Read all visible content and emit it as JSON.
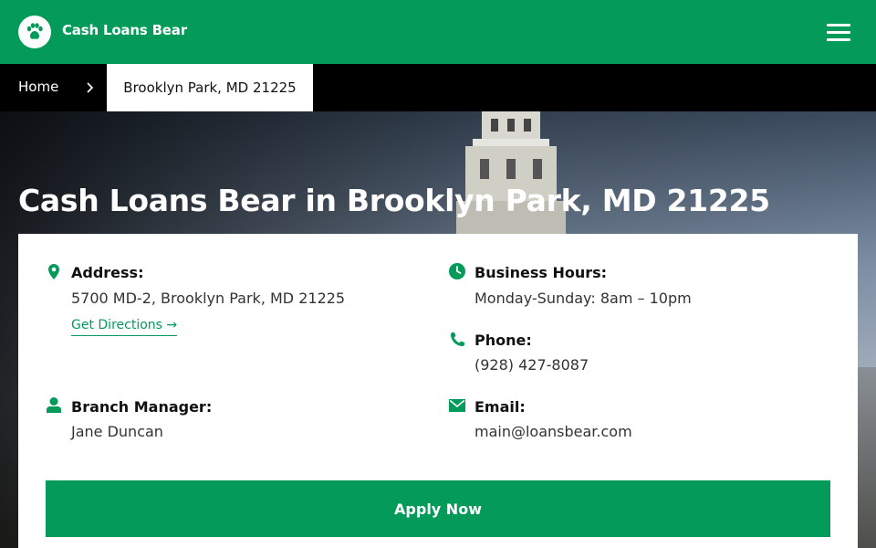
{
  "header": {
    "brand": "Cash Loans Bear",
    "logo_icon": "paw-icon",
    "menu_icon": "hamburger-menu-icon",
    "bg_color": "#049a5a"
  },
  "breadcrumb": {
    "home": "Home",
    "current": "Brooklyn Park, MD 21225"
  },
  "page": {
    "title": "Cash Loans Bear in Brooklyn Park, MD 21225"
  },
  "info": {
    "address": {
      "label": "Address:",
      "value": "5700 MD-2, Brooklyn Park, MD 21225",
      "link": "Get Directions",
      "icon": "map-pin-icon"
    },
    "hours": {
      "label": "Business Hours:",
      "value": "Monday-Sunday: 8am – 10pm",
      "icon": "clock-icon"
    },
    "phone": {
      "label": "Phone:",
      "value": "(928) 427-8087",
      "icon": "phone-icon"
    },
    "manager": {
      "label": "Branch Manager:",
      "value": "Jane Duncan",
      "icon": "user-icon"
    },
    "email": {
      "label": "Email:",
      "value": "main@loansbear.com",
      "icon": "envelope-icon"
    }
  },
  "cta": {
    "apply": "Apply Now"
  },
  "colors": {
    "accent": "#049a5a",
    "breadcrumb_bg": "#000000"
  }
}
